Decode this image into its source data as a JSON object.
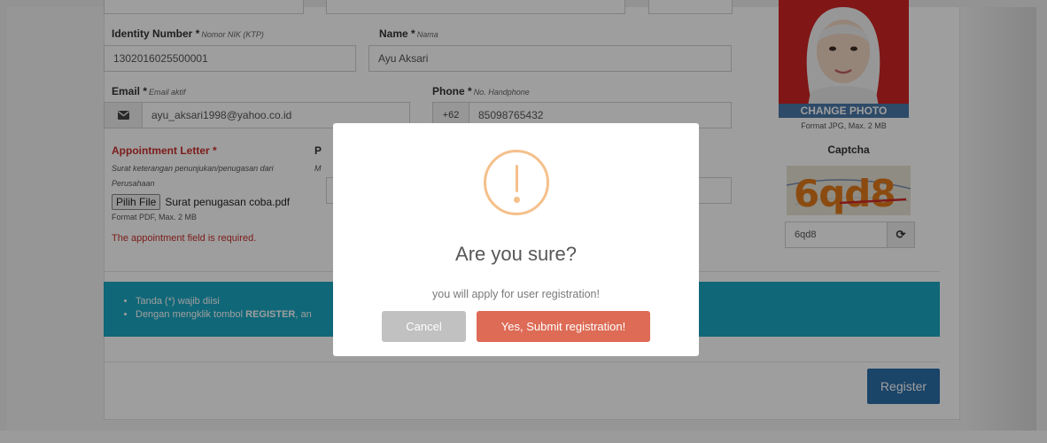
{
  "form": {
    "identity": {
      "label": "Identity Number",
      "required": "*",
      "sub": "Nomor NIK (KTP)",
      "value": "1302016025500001"
    },
    "name": {
      "label": "Name",
      "required": "*",
      "sub": "Nama",
      "value": "Ayu Aksari"
    },
    "email": {
      "label": "Email",
      "required": "*",
      "sub": "Email aktif",
      "value": "ayu_aksari1998@yahoo.co.id"
    },
    "phone": {
      "label": "Phone",
      "required": "*",
      "sub": "No. Handphone",
      "prefix": "+62",
      "value": "85098765432"
    },
    "appointment": {
      "label": "Appointment Letter",
      "required": "*",
      "sub_line1": "Surat keterangan penunjukan/penugasan dari",
      "sub_line2": "Perusahaan",
      "file_button": "Pilih File",
      "file_name": "Surat penugasan coba.pdf",
      "format": "Format PDF, Max. 2 MB",
      "error": "The appointment field is required."
    },
    "hidden_label_initial": "P",
    "hidden_sub_initial": "M"
  },
  "photo": {
    "change_label": "CHANGE PHOTO",
    "format": "Format JPG, Max. 2 MB"
  },
  "captcha": {
    "label": "Captcha",
    "image_text": "6qd8",
    "input_value": "6qd8"
  },
  "info": {
    "item1": "Tanda (*) wajib diisi",
    "item2_prefix": "Dengan mengklik tombol ",
    "item2_bold": "REGISTER",
    "item2_suffix": ", an"
  },
  "register_button": "Register",
  "modal": {
    "title": "Are you sure?",
    "text": "you will apply for user registration!",
    "cancel": "Cancel",
    "confirm": "Yes, Submit registration!"
  },
  "colors": {
    "error": "#c9302c",
    "info_bg": "#1aa6c2",
    "register_bg": "#2b6fa8",
    "confirm_bg": "#dd6b55",
    "cancel_bg": "#c1c1c1",
    "warning_icon": "#f5c08b"
  }
}
